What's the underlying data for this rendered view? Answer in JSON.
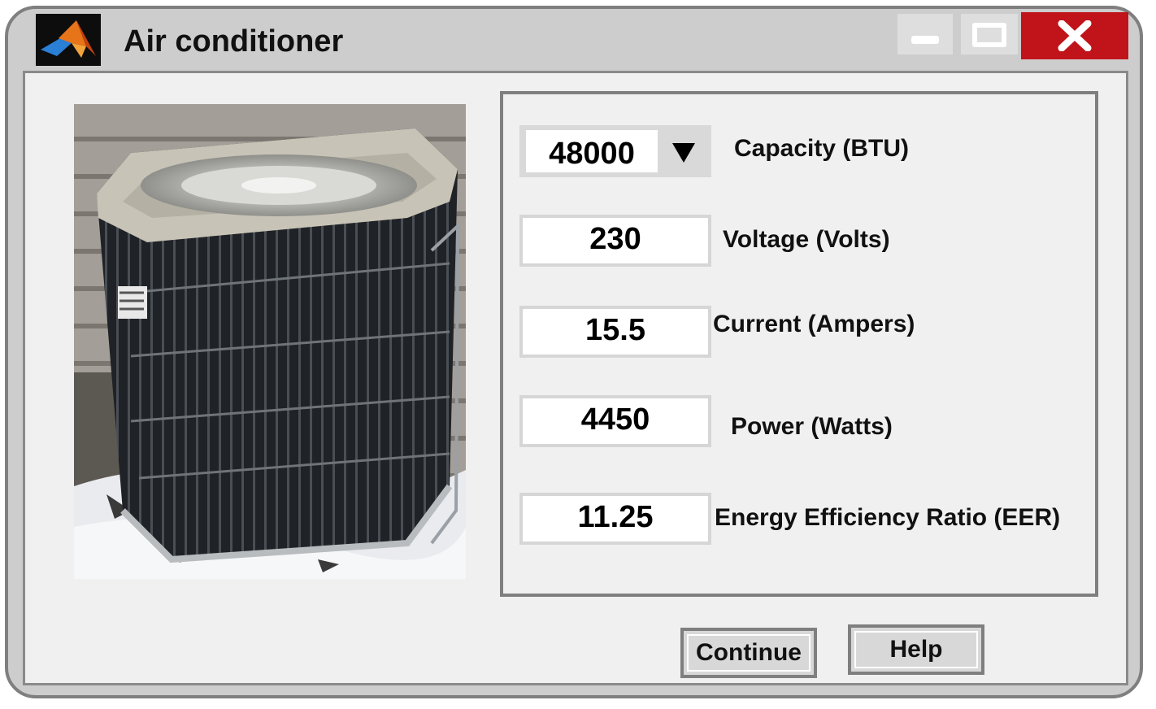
{
  "window": {
    "title": "Air conditioner",
    "app_icon": "matlab-icon",
    "controls": {
      "minimize_icon": "minimize-icon",
      "maximize_icon": "maximize-icon",
      "close_icon": "close-icon"
    },
    "close_color": "#c0141a"
  },
  "image": {
    "subject": "air-conditioner-outdoor-unit"
  },
  "fields": {
    "capacity": {
      "value": "48000",
      "label": "Capacity (BTU)",
      "arrow_icon": "dropdown-arrow-icon"
    },
    "voltage": {
      "value": "230",
      "label": "Voltage (Volts)"
    },
    "current": {
      "value": "15.5",
      "label": "Current (Ampers)"
    },
    "power": {
      "value": "4450",
      "label": "Power (Watts)"
    },
    "eer": {
      "value": "11.25",
      "label": "Energy Efficiency Ratio (EER)"
    }
  },
  "buttons": {
    "continue_label": "Continue",
    "help_label": "Help"
  }
}
